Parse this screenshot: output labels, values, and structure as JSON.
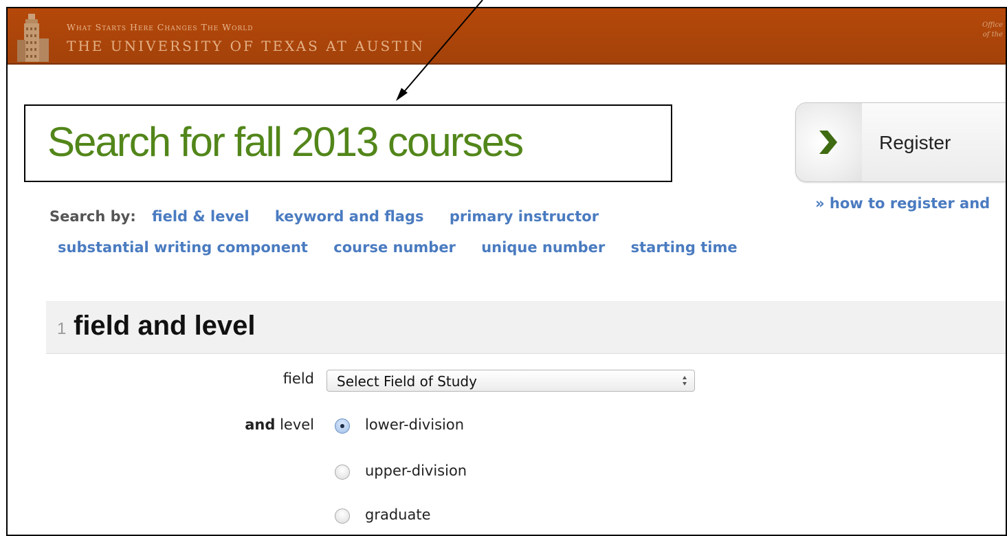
{
  "header": {
    "tagline": "What Starts Here Changes The World",
    "university": "THE UNIVERSITY OF TEXAS AT AUSTIN",
    "office_line1": "Office",
    "office_line2": "of the",
    "brand_color": "#b5480a"
  },
  "page": {
    "title": "Search for fall 2013 courses",
    "title_color": "#52861a"
  },
  "register": {
    "label": "Register",
    "icon": "chevron-right-icon",
    "how_to_link": "» how to register and"
  },
  "search_by": {
    "label": "Search by:",
    "links": [
      "field & level",
      "keyword and flags",
      "primary instructor",
      "substantial writing component",
      "course number",
      "unique number",
      "starting time"
    ],
    "link_color": "#4a7bc0"
  },
  "section": {
    "number": "1",
    "title": "field and level"
  },
  "form": {
    "field_label": "field",
    "field_select_value": "Select Field of Study",
    "level_label_bold": "and",
    "level_label": "level",
    "level_options": [
      "lower-division",
      "upper-division",
      "graduate"
    ],
    "level_selected": "lower-division"
  }
}
